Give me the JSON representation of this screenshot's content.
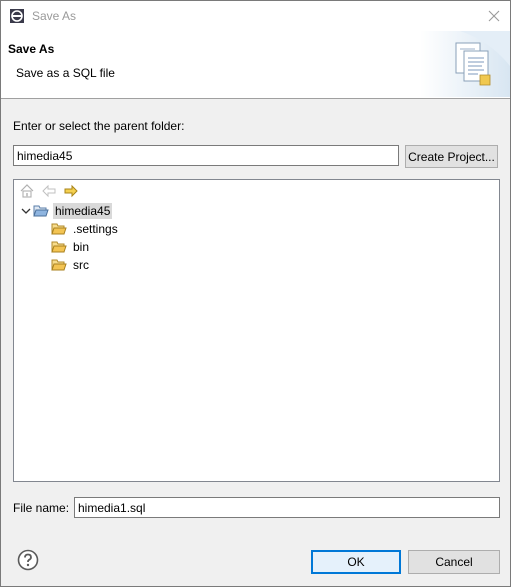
{
  "window": {
    "title": "Save As"
  },
  "banner": {
    "title": "Save As",
    "description": "Save as a SQL file"
  },
  "parent_folder": {
    "label": "Enter or select the parent folder:",
    "value": "himedia45",
    "create_button": "Create Project..."
  },
  "tree": {
    "toolbar_icons": [
      "home-icon",
      "back-arrow-icon",
      "forward-arrow-icon"
    ],
    "root": {
      "label": "himedia45",
      "expanded": true,
      "selected": true,
      "children": [
        {
          "label": ".settings"
        },
        {
          "label": "bin"
        },
        {
          "label": "src"
        }
      ]
    }
  },
  "file_name": {
    "label": "File name:",
    "value": "himedia1.sql"
  },
  "buttons": {
    "ok": "OK",
    "cancel": "Cancel",
    "help_icon": "help-icon"
  },
  "colors": {
    "accent": "#0078d7",
    "folder": "#e8b84a",
    "forward_arrow": "#e0b020"
  }
}
